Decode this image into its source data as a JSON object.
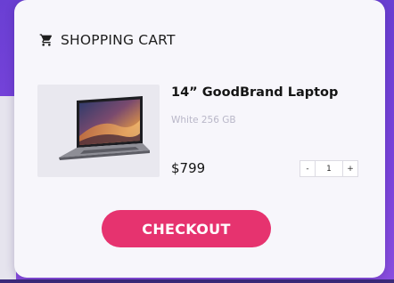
{
  "header": {
    "title": "SHOPPING CART",
    "icon": "shopping-cart-icon"
  },
  "product": {
    "name": "14” GoodBrand Laptop",
    "variant": "White 256 GB",
    "price": "$799",
    "image": "laptop-image"
  },
  "quantity": {
    "decrement_label": "-",
    "value": "1",
    "increment_label": "+"
  },
  "checkout": {
    "label": "CHECKOUT"
  },
  "colors": {
    "accent": "#e6336f",
    "background": "#7b44dc",
    "panel": "#f7f6fb",
    "muted_text": "#b9b7c8"
  }
}
